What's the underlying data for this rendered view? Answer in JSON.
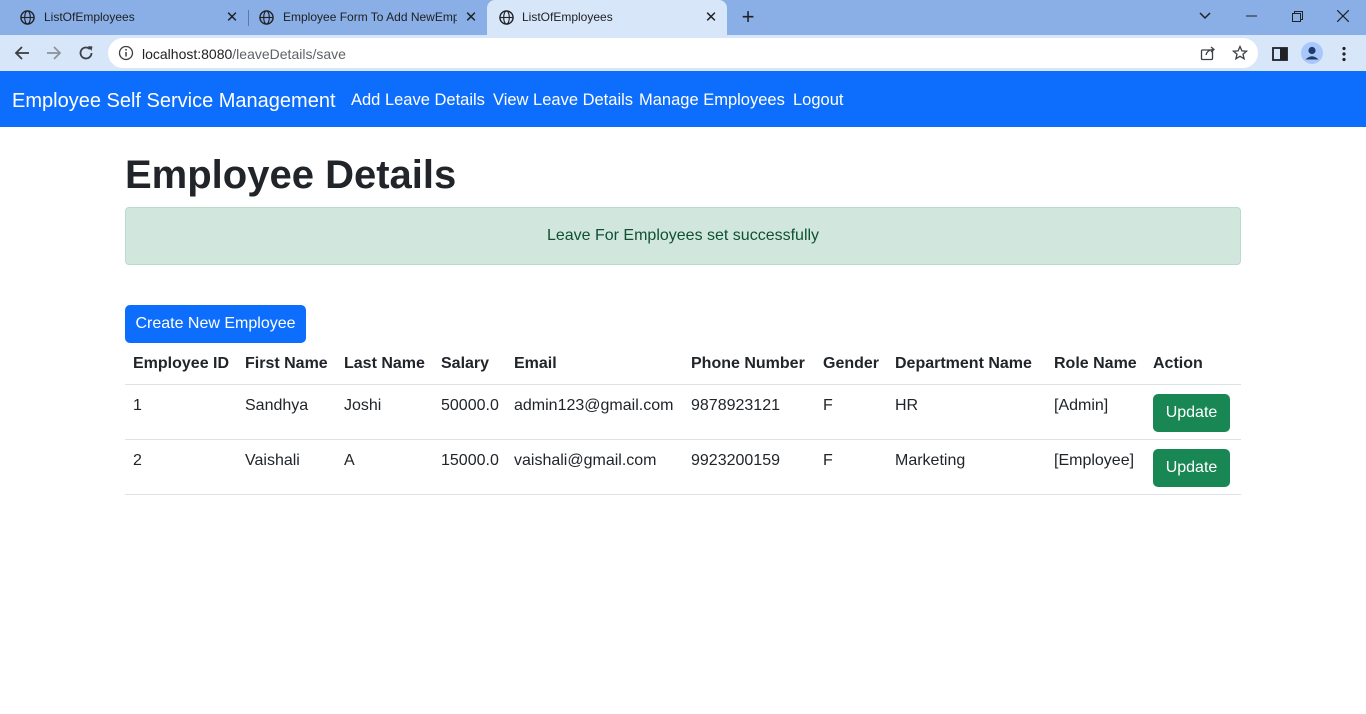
{
  "browser": {
    "tabs": [
      {
        "title": "ListOfEmployees",
        "active": false
      },
      {
        "title": "Employee Form To Add NewEmp",
        "active": false
      },
      {
        "title": "ListOfEmployees",
        "active": true
      }
    ],
    "url_host": "localhost:8080",
    "url_path": "/leaveDetails/save",
    "chrome_color": "#8aafe6",
    "toolbar_color": "#d8e6fa"
  },
  "navbar": {
    "brand": "Employee Self Service Management",
    "links": [
      "Add Leave Details",
      "View Leave Details",
      "Manage Employees",
      "Logout"
    ],
    "color": "#0d6efd"
  },
  "page": {
    "title": "Employee Details",
    "alert": "Leave For Employees set successfully",
    "create_button": "Create New Employee"
  },
  "table": {
    "headers": [
      "Employee ID",
      "First Name",
      "Last Name",
      "Salary",
      "Email",
      "Phone Number",
      "Gender",
      "Department Name",
      "Role Name",
      "Action"
    ],
    "rows": [
      {
        "id": "1",
        "first": "Sandhya",
        "last": "Joshi",
        "salary": "50000.0",
        "email": "admin123@gmail.com",
        "phone": "9878923121",
        "gender": "F",
        "department": "HR",
        "role": "[Admin]",
        "action": "Update"
      },
      {
        "id": "2",
        "first": "Vaishali",
        "last": "A",
        "salary": "15000.0",
        "email": "vaishali@gmail.com",
        "phone": "9923200159",
        "gender": "F",
        "department": "Marketing",
        "role": "[Employee]",
        "action": "Update"
      }
    ]
  },
  "colors": {
    "alert_bg": "#d1e7dd",
    "alert_text": "#0f5132",
    "update_button": "#198754"
  }
}
